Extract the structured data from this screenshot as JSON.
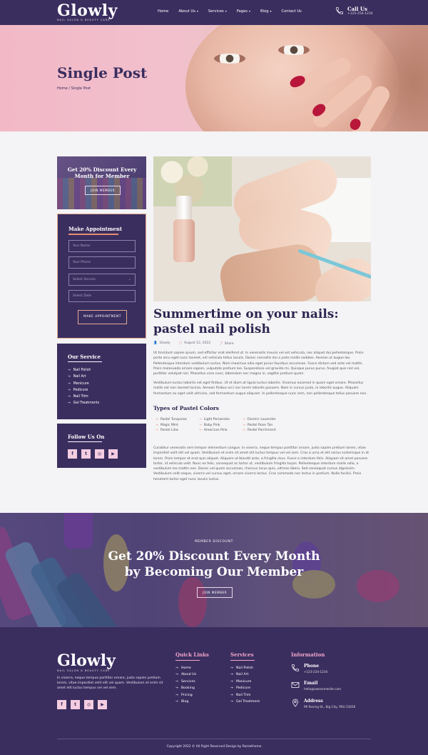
{
  "header": {
    "logo_name": "Glowly",
    "logo_tag": "NAIL SALON & BEAUTY CARE",
    "nav": [
      {
        "label": "Home",
        "dropdown": false
      },
      {
        "label": "About Us",
        "dropdown": true
      },
      {
        "label": "Services",
        "dropdown": true
      },
      {
        "label": "Pages",
        "dropdown": true
      },
      {
        "label": "Blog",
        "dropdown": true
      },
      {
        "label": "Contact Us",
        "dropdown": false
      }
    ],
    "call_label": "Call Us",
    "call_number": "+125-254-1234"
  },
  "hero": {
    "title": "Single Post",
    "breadcrumb": "Home / Single Post"
  },
  "sidebar": {
    "promo_title": "Get 20% Discount Every Month for Member",
    "promo_button": "JOIN MEMBER",
    "appointment": {
      "title": "Make Appointment",
      "fields": [
        "Your Name",
        "Your Phone",
        "Select Service",
        "Select Date"
      ],
      "submit": "MAKE APPOINTMENT"
    },
    "services": {
      "title": "Our Service",
      "items": [
        "Nail Polish",
        "Nail Art",
        "Manicure",
        "Pedicure",
        "Nail Trim",
        "Gel Treatments"
      ]
    },
    "follow": {
      "title": "Follow Us On",
      "icons": [
        "f",
        "t",
        "◎",
        "▶"
      ]
    }
  },
  "post": {
    "title": "Summertime on your nails: pastel nail polish",
    "author": "Glowly",
    "date": "August 12, 2022",
    "share": "Share",
    "para1": "Ut tincidunt sapien ipsum, sed efficitur erat eleifend ut. In venenatis mauris vel est vehicula, nec aliquet dui pellentesque. Proin porta arcu eget nunc laoreet, vel vehicula tellus iaculis. Donec convallis dui a justo mollis sodales. Aenean ut augue leo. Pellentesque interdum vestibulum luctus. Nam maximus odio eget purus faucibus accumsan. Fusce dictum sed ante vel mattis. Proin malesuada ornare sapien, vulputate pretium leo. Suspendisse vel gravida mi. Quisque purus purus, feugiat quis nisl vel, porttitor volutpat nisl. Phasellus urna nunc, bibendum nec magna in, sagittis pretium quam.",
    "para2": "Vestibulum luctus lobortis est eget finibus. Ut et diam at ligula luctus lobortis. Vivamus euismod in quam eget ornare. Phasellus mollis est non laoreet lacinia. Aenean finibus orci nec lorem lobortis posuere. Nam in cursus justo, in lobortis augue. Aliquam fermentum ex eget velit ultricies, sed fermentum augue aliquam. In pellentesque nunc sem, non pellentesque tellus posuere non.",
    "subheading": "Types of Pastel Colors",
    "colors": [
      "Pastel Turquoise",
      "Light Periwinkle",
      "Electric Lavender",
      "Magic Mint",
      "Baby Pink",
      "Pastel Rose Tan",
      "Pastel Lilac",
      "American Pink",
      "Pastel Parchment"
    ],
    "para3": "Curabitur venenatis sem tempor elementum congue. In viverra, neque tempus porttitor ornare, justo sapien pretium lorem, vitae imperdiet velit elit vel quam. Vestibulum et enim sit amet elit luctus tempus vel vel sem. Cras a urna et elit varius scelerisque in at lorem. Proin tempor et erat quis aliquet. Aliquam ut blandit ante, a fringilla risus. Fusce a interdum felis. Aliquam sit amet posuere tortor, id vehicula velit. Nunc ex felis, consequat ac tortor ut, vestibulum fringilla turpis. Pellentesque interdum mollis odio, a vestibulum leo mattis non. Donec vel quam accumsan, rhoncus lacus quis, ultrices libero. Sed consequat cursus dignissim. Vestibulum velit neque, viverra vel cursus eget, ornare viverra lectus. Cras commodo nec lectus in pretium. Nulla facilisi. Proin hendrerit tortor eget nunc iaculis luctus."
  },
  "banner": {
    "small": "MEMBER DISCOUNT",
    "title": "Get 20% Discount Every Month by Becoming Our Member",
    "button": "JOIN MEMBER"
  },
  "footer": {
    "logo_name": "Glowly",
    "logo_tag": "NAIL SALON & BEAUTY CARE",
    "about": "In viverra, neque tempus porttitor ornare, justo sapien pretium lorem, vitae imperdiet velit elit vel quam. Vestibulum et enim sit amet elit luctus tempus vel vel sem.",
    "social": [
      "f",
      "t",
      "◎",
      "▶"
    ],
    "quick_links": {
      "title": "Quick Links",
      "items": [
        "Home",
        "About Us",
        "Services",
        "Booking",
        "Pricing",
        "Blog"
      ]
    },
    "services": {
      "title": "Services",
      "items": [
        "Nail Polish",
        "Nail Art",
        "Manicure",
        "Pedicure",
        "Nail Trim",
        "Gel Treatment"
      ]
    },
    "information": {
      "title": "Information",
      "phone_label": "Phone",
      "phone": "+123-234-1234",
      "email_label": "Email",
      "email": "hello@awesomesite.com",
      "address_label": "Address",
      "address": "99 Roving St., Big City, PKU 23456"
    },
    "copyright": "Copyright 2022 © All Right Reserved Design by Rometheme"
  },
  "colors": {
    "primary": "#3a2e5f",
    "accent": "#e5a98e",
    "pink": "#f4cde0"
  }
}
